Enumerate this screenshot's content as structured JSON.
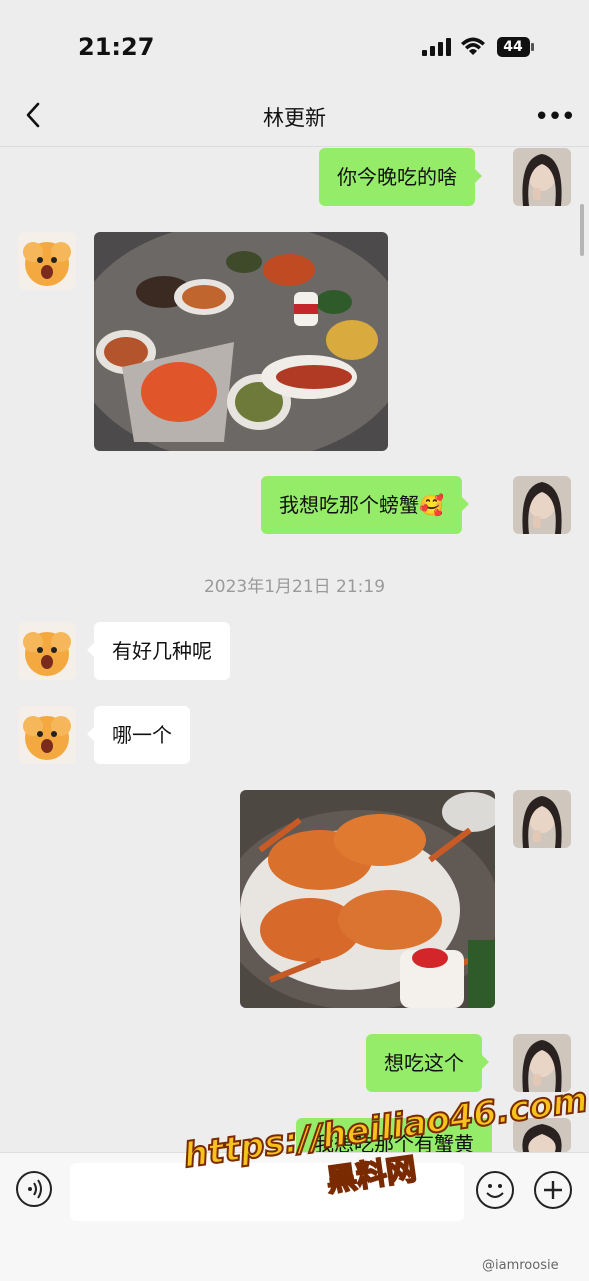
{
  "status_bar": {
    "time": "21:27",
    "battery": "44"
  },
  "nav": {
    "title": "林更新"
  },
  "messages": {
    "m1": "你今晚吃的啥",
    "m3": "我想吃那个螃蟹🥰",
    "timestamp": "2023年1月21日 21:19",
    "m4": "有好几种呢",
    "m5": "哪一个",
    "m7": "想吃这个",
    "m8_partial": "我想吃那个有蟹黄"
  },
  "watermark": {
    "url": "https://heiliao46.com",
    "name": "黑料网",
    "weibo": "@iamroosie"
  },
  "icons": [
    "back-icon",
    "more-icon",
    "voice-icon",
    "emoji-icon",
    "plus-icon",
    "signal-icon",
    "wifi-icon",
    "battery-icon"
  ],
  "colors": {
    "my_bubble": "#95ec69",
    "their_bubble": "#ffffff",
    "background": "#ededed"
  }
}
